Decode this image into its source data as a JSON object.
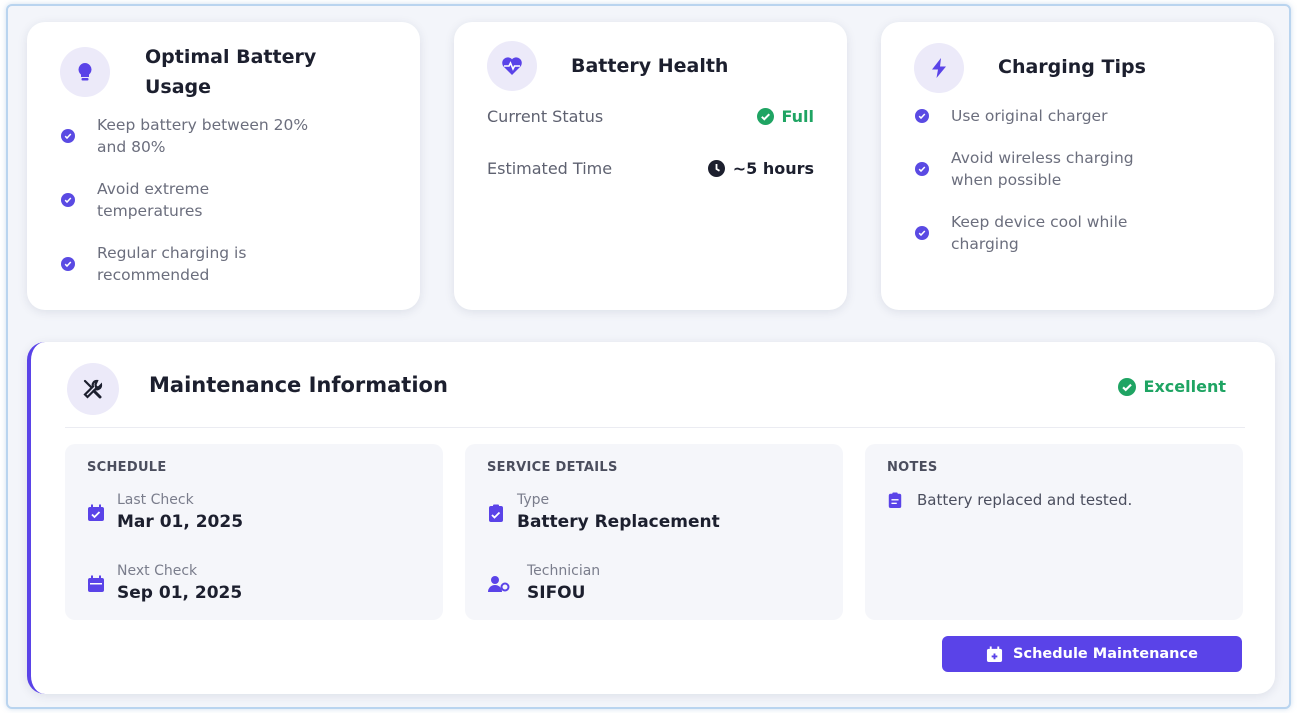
{
  "battery_usage": {
    "title_line1": "Optimal Battery",
    "title_line2": "Usage",
    "tips": [
      {
        "line1": "Keep battery between 20%",
        "line2": "and 80%"
      },
      {
        "line1": "Avoid extreme",
        "line2": "temperatures"
      },
      {
        "line1": "Regular charging is",
        "line2": "recommended"
      }
    ],
    "icon": "lightbulb-icon"
  },
  "battery_health": {
    "title": "Battery Health",
    "status_label": "Current Status",
    "status_value": "Full",
    "time_label": "Estimated Time",
    "time_value": "~5 hours",
    "icon": "heart-pulse-icon"
  },
  "charging_tips": {
    "title": "Charging Tips",
    "tips": [
      {
        "line1": "Use original charger",
        "line2": ""
      },
      {
        "line1": "Avoid wireless charging",
        "line2": "when possible"
      },
      {
        "line1": "Keep device cool while",
        "line2": "charging"
      }
    ],
    "icon": "bolt-icon"
  },
  "maintenance": {
    "title": "Maintenance Information",
    "status": "Excellent",
    "schedule": {
      "heading": "SCHEDULE",
      "last_label": "Last Check",
      "last_value": "Mar 01, 2025",
      "next_label": "Next Check",
      "next_value": "Sep 01, 2025"
    },
    "service": {
      "heading": "SERVICE DETAILS",
      "type_label": "Type",
      "type_value": "Battery Replacement",
      "tech_label": "Technician",
      "tech_value": "SIFOU"
    },
    "notes": {
      "heading": "NOTES",
      "text": "Battery replaced and tested."
    },
    "button_label": "Schedule Maintenance",
    "icon": "tools-icon"
  },
  "colors": {
    "accent": "#5a43e8",
    "success": "#1fa463",
    "icon_bg": "#eceaf9"
  }
}
